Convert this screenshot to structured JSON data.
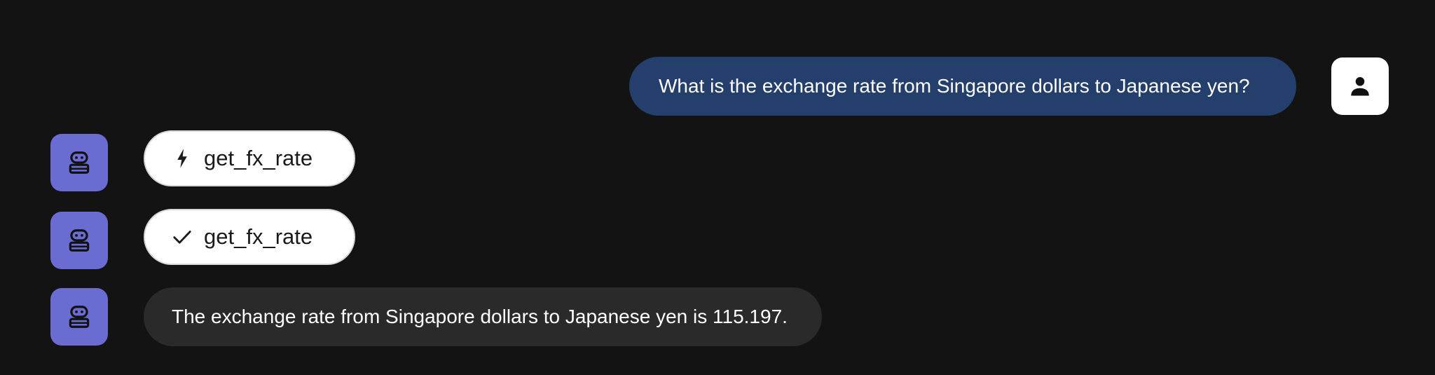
{
  "colors": {
    "background": "#131313",
    "user_bubble": "#243f6b",
    "bot_avatar": "#6a6cd1",
    "bot_bubble": "#2a2a2a",
    "chip_background": "#ffffff"
  },
  "messages": {
    "user_question": {
      "text": "What is the exchange rate from Singapore dollars to Japanese yen?",
      "avatar_icon": "person-icon"
    },
    "tool_call": {
      "label": "get_fx_rate",
      "icon": "lightning-bolt-icon",
      "avatar_icon": "robot-icon"
    },
    "tool_result": {
      "label": "get_fx_rate",
      "icon": "checkmark-icon",
      "avatar_icon": "robot-icon"
    },
    "bot_answer": {
      "text": "The exchange rate from Singapore dollars to Japanese yen is 115.197.",
      "avatar_icon": "robot-icon"
    }
  }
}
